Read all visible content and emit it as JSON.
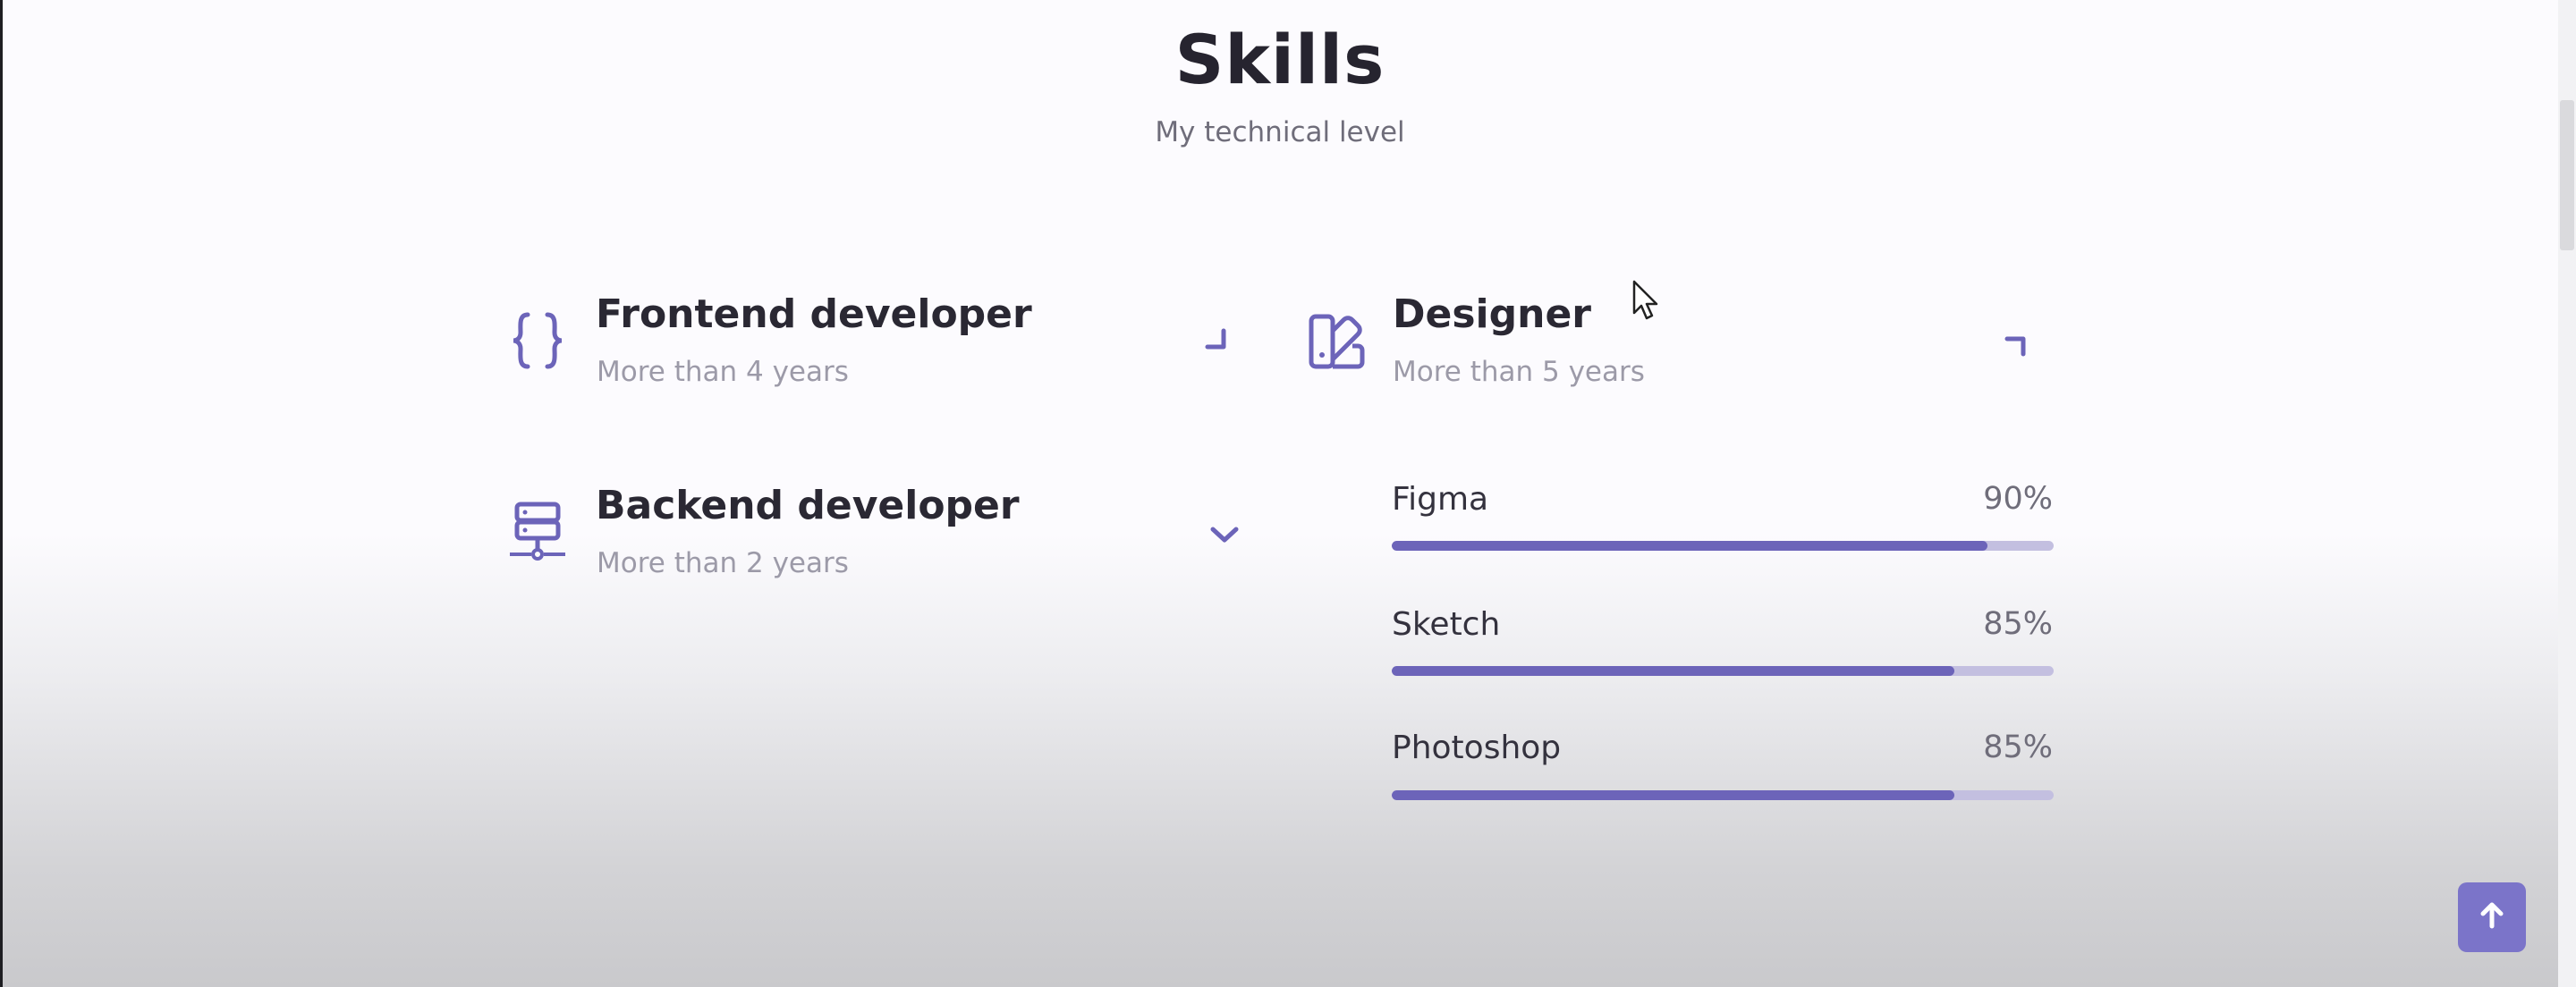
{
  "section": {
    "title": "Skills",
    "subtitle": "My technical level"
  },
  "skills": [
    {
      "title": "Frontend developer",
      "subtitle": "More than 4 years",
      "icon": "code-braces-icon",
      "state": "open",
      "arrow_icon": "chevron-corner-icon"
    },
    {
      "title": "Backend developer",
      "subtitle": "More than 2 years",
      "icon": "server-icon",
      "state": "closed",
      "arrow_icon": "chevron-down-icon"
    },
    {
      "title": "Designer",
      "subtitle": "More than 5 years",
      "icon": "swatchbook-icon",
      "state": "open",
      "arrow_icon": "chevron-corner-icon"
    }
  ],
  "designer_bars": [
    {
      "name": "Figma",
      "percent": "90%",
      "value": 90
    },
    {
      "name": "Sketch",
      "percent": "85%",
      "value": 85
    },
    {
      "name": "Photoshop",
      "percent": "85%",
      "value": 85
    }
  ],
  "colors": {
    "accent": "#6c64b9",
    "track": "#c3bfe0",
    "scroll_button": "#7b74c9"
  },
  "scroll_up_icon": "arrow-up-icon"
}
